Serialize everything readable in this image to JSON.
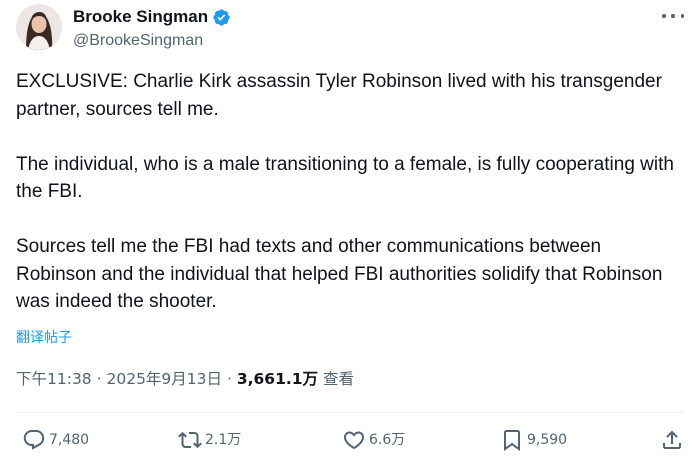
{
  "author": {
    "display_name": "Brooke Singman",
    "handle": "@BrookeSingman",
    "verified": true
  },
  "tweet": {
    "paragraphs": [
      "EXCLUSIVE: Charlie Kirk assassin Tyler Robinson lived with his transgender partner, sources tell me.",
      "The individual, who is a male transitioning to a female, is fully cooperating with the FBI.",
      "Sources tell me the FBI had texts and other communications between Robinson and the individual that helped FBI authorities solidify that Robinson was indeed the shooter."
    ],
    "translate_label": "翻译帖子",
    "time": "下午11:38",
    "date": "2025年9月13日",
    "separator": "·",
    "views_count": "3,661.1万",
    "views_label": "查看"
  },
  "actions": {
    "replies": "7,480",
    "retweets": "2.1万",
    "likes": "6.6万",
    "bookmarks": "9,590"
  },
  "colors": {
    "accent": "#1d9bf0",
    "secondary_text": "#536471",
    "primary_text": "#0f1419"
  },
  "icons": {
    "verified": "verified-badge-icon",
    "more": "more-icon",
    "reply": "reply-icon",
    "retweet": "retweet-icon",
    "like": "heart-icon",
    "bookmark": "bookmark-icon",
    "share": "share-icon"
  }
}
